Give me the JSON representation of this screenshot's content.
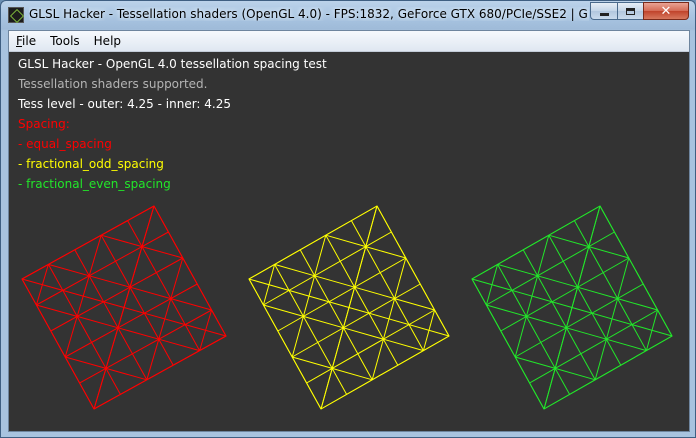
{
  "window": {
    "title": "GLSL Hacker - Tessellation shaders (OpenGL 4.0) - FPS:1832, GeForce GTX 680/PCIe/SSE2 | GLSL Hacke..."
  },
  "menu": {
    "file": {
      "accel": "F",
      "rest": "ile"
    },
    "tools": {
      "accel": "",
      "rest": "Tools"
    },
    "help": {
      "accel": "",
      "rest": "Help"
    }
  },
  "info": {
    "line1": "GLSL Hacker - OpenGL 4.0 tessellation spacing test",
    "line2": "Tessellation shaders supported.",
    "line3": "Tess level - outer: 4.25 - inner: 4.25",
    "line4": "Spacing:",
    "line5": "- equal_spacing",
    "line6": "- fractional_odd_spacing",
    "line7": "- fractional_even_spacing"
  },
  "colors": {
    "background": "#333333",
    "title_text": "#ffffff",
    "dim_text": "#b4b4b4",
    "equal": "#ff0000",
    "odd": "#ffff00",
    "even": "#22e62a"
  },
  "icons": {
    "app": "glsl-hacker-icon",
    "minimize": "minimize-icon",
    "maximize": "maximize-icon",
    "close": "close-icon"
  }
}
